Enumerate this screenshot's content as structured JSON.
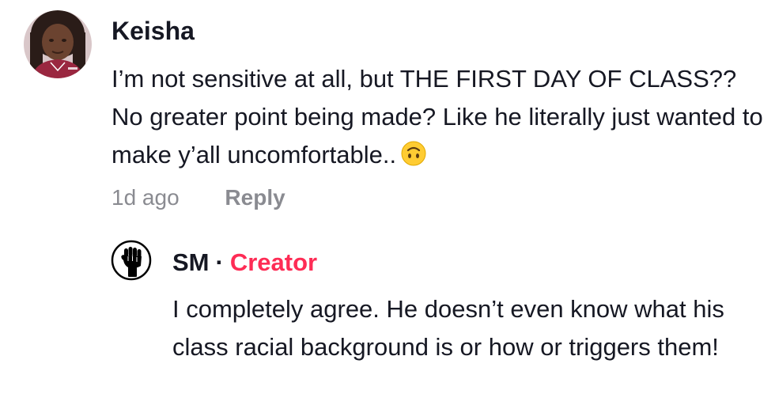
{
  "comment": {
    "username": "Keisha",
    "text": "I’m not sensitive at all, but THE FIRST DAY OF CLASS?? No greater point being made? Like he literally just wanted to make y’all uncomfortable..",
    "emoji": "upside-down-face",
    "time": "1d ago",
    "reply_label": "Reply"
  },
  "reply": {
    "username": "SM",
    "separator": "·",
    "badge": "Creator",
    "badge_color": "#fe2c55",
    "avatar_icon": "raised-fist-icon",
    "text": "I completely agree. He doesn’t even know what his class racial background is or how or triggers them!"
  }
}
